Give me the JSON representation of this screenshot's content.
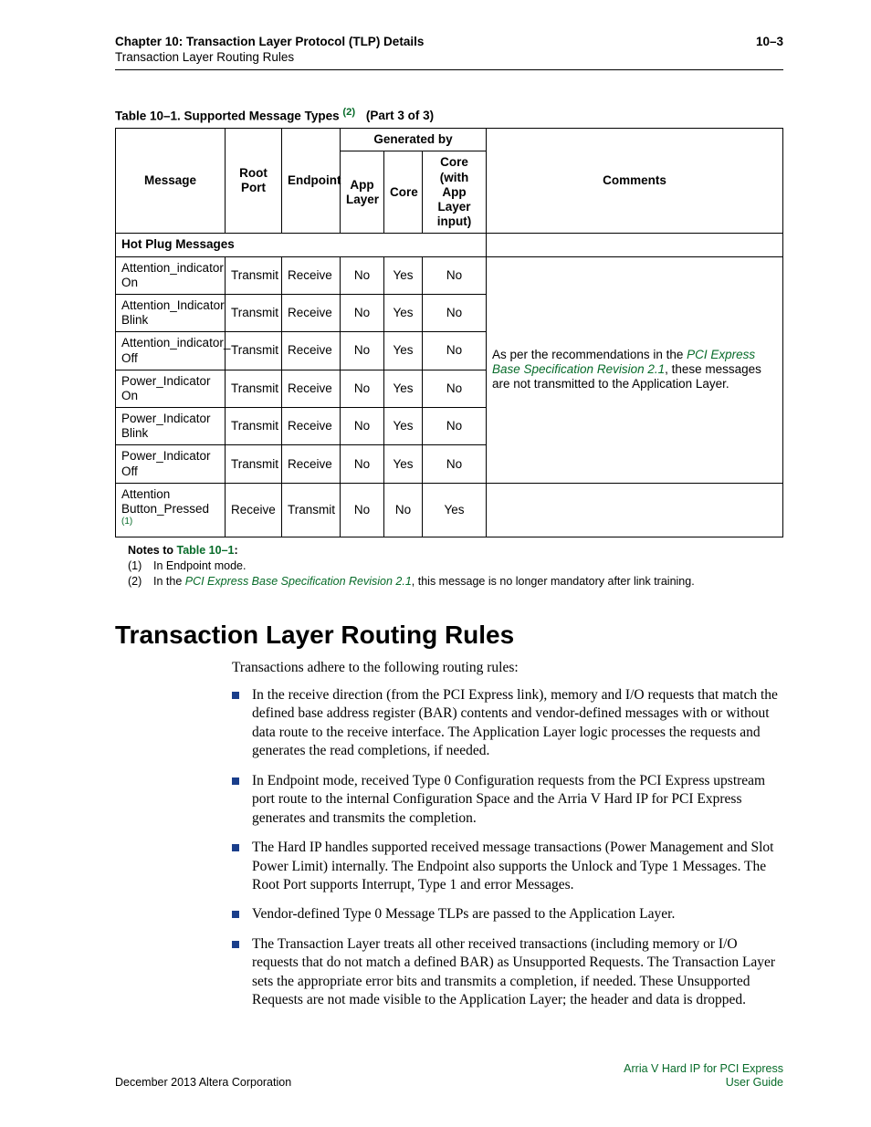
{
  "header": {
    "chapter": "Chapter 10:  Transaction Layer Protocol (TLP) Details",
    "section": "Transaction Layer Routing Rules",
    "page": "10–3"
  },
  "table": {
    "caption_prefix": "Table 10–1.  Supported Message Types",
    "caption_sup": "(2)",
    "caption_part": "(Part 3 of 3)",
    "head": {
      "message": "Message",
      "root_port": "Root Port",
      "endpoint": "Endpoint",
      "generated_by": "Generated by",
      "app_layer": "App Layer",
      "core": "Core",
      "core_with": "Core (with App Layer input)",
      "comments": "Comments"
    },
    "section_label": "Hot Plug Messages",
    "rows": [
      {
        "msg": "Attention_indicator On",
        "rp": "Transmit",
        "ep": "Receive",
        "al": "No",
        "core": "Yes",
        "cw": "No"
      },
      {
        "msg": "Attention_Indicator Blink",
        "rp": "Transmit",
        "ep": "Receive",
        "al": "No",
        "core": "Yes",
        "cw": "No"
      },
      {
        "msg": "Attention_indicator_ Off",
        "rp": "Transmit",
        "ep": "Receive",
        "al": "No",
        "core": "Yes",
        "cw": "No"
      },
      {
        "msg": "Power_Indicator On",
        "rp": "Transmit",
        "ep": "Receive",
        "al": "No",
        "core": "Yes",
        "cw": "No"
      },
      {
        "msg": "Power_Indicator Blink",
        "rp": "Transmit",
        "ep": "Receive",
        "al": "No",
        "core": "Yes",
        "cw": "No"
      },
      {
        "msg": "Power_Indicator Off",
        "rp": "Transmit",
        "ep": "Receive",
        "al": "No",
        "core": "Yes",
        "cw": "No"
      }
    ],
    "last_row": {
      "msg_pre": "Attention Button_Pressed",
      "msg_sup": "(1)",
      "rp": "Receive",
      "ep": "Transmit",
      "al": "No",
      "core": "No",
      "cw": "Yes"
    },
    "comments_pre": "As per the recommendations in the ",
    "comments_link": "PCI Express Base Specification Revision 2.1",
    "comments_post": ", these messages are not transmitted to the Application Layer."
  },
  "notes": {
    "title_pre": "Notes to ",
    "title_link": "Table 10–1",
    "title_post": ":",
    "items": [
      {
        "num": "(1)",
        "text_pre": "In Endpoint mode.",
        "link": "",
        "text_post": ""
      },
      {
        "num": "(2)",
        "text_pre": "In the ",
        "link": "PCI Express Base Specification Revision 2.1",
        "text_post": ", this message is no longer mandatory after link training."
      }
    ]
  },
  "section": {
    "heading": "Transaction Layer Routing Rules",
    "intro": "Transactions adhere to the following routing rules:",
    "bullets": [
      "In the receive direction (from the PCI Express link), memory and I/O requests that match the defined base address register (BAR) contents and vendor-defined messages with or without data route to the receive interface. The Application Layer logic processes the requests and generates the read completions, if needed.",
      "In Endpoint mode, received Type 0 Configuration requests from the PCI Express upstream port route to the internal Configuration Space and the Arria  V Hard IP for PCI Express generates and transmits the completion.",
      "The Hard IP handles supported received message transactions (Power Management and Slot Power Limit) internally. The Endpoint also supports the Unlock and Type 1 Messages. The Root Port supports Interrupt, Type 1 and error Messages.",
      "Vendor-defined Type 0 Message TLPs are passed to the Application Layer.",
      "The Transaction Layer treats all other received transactions (including memory or I/O requests that do not match a defined BAR) as Unsupported Requests. The Transaction Layer sets the appropriate error bits and transmits a completion, if needed. These Unsupported Requests are not made visible to the Application Layer; the header and data is dropped."
    ]
  },
  "footer": {
    "left": "December 2013   Altera Corporation",
    "right1": "Arria V Hard IP for PCI Express",
    "right2": "User Guide"
  }
}
